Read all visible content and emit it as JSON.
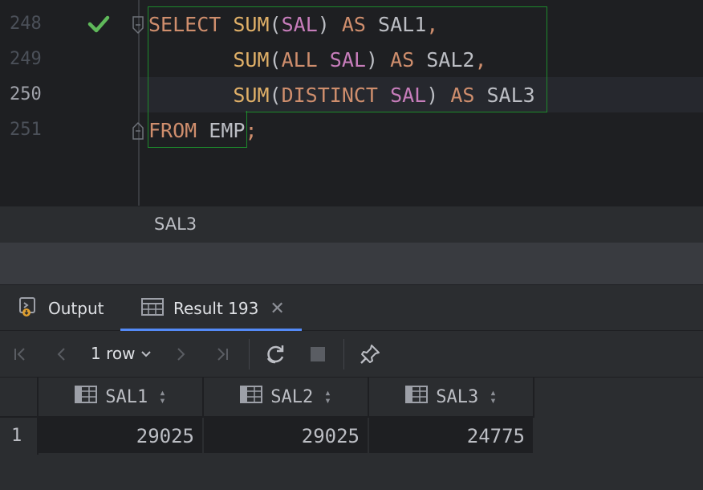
{
  "editor": {
    "lines": [
      {
        "number": "248",
        "segments": [
          {
            "t": "SELECT",
            "c": "kw"
          },
          {
            "t": " ",
            "c": "punc"
          },
          {
            "t": "SUM",
            "c": "fn"
          },
          {
            "t": "(",
            "c": "punc"
          },
          {
            "t": "SAL",
            "c": "col"
          },
          {
            "t": ")",
            "c": "punc"
          },
          {
            "t": " ",
            "c": "punc"
          },
          {
            "t": "AS",
            "c": "kw"
          },
          {
            "t": " SAL1",
            "c": "alias"
          },
          {
            "t": ",",
            "c": "semi"
          }
        ]
      },
      {
        "number": "249",
        "segments": [
          {
            "t": "       ",
            "c": "punc"
          },
          {
            "t": "SUM",
            "c": "fn"
          },
          {
            "t": "(",
            "c": "punc"
          },
          {
            "t": "ALL",
            "c": "kw"
          },
          {
            "t": " ",
            "c": "punc"
          },
          {
            "t": "SAL",
            "c": "col"
          },
          {
            "t": ")",
            "c": "punc"
          },
          {
            "t": " ",
            "c": "punc"
          },
          {
            "t": "AS",
            "c": "kw"
          },
          {
            "t": " SAL2",
            "c": "alias"
          },
          {
            "t": ",",
            "c": "semi"
          }
        ]
      },
      {
        "number": "250",
        "segments": [
          {
            "t": "       ",
            "c": "punc"
          },
          {
            "t": "SUM",
            "c": "fn"
          },
          {
            "t": "(",
            "c": "punc"
          },
          {
            "t": "DISTINCT",
            "c": "kw"
          },
          {
            "t": " ",
            "c": "punc"
          },
          {
            "t": "SAL",
            "c": "col"
          },
          {
            "t": ")",
            "c": "punc"
          },
          {
            "t": " ",
            "c": "punc"
          },
          {
            "t": "AS",
            "c": "kw"
          },
          {
            "t": " SAL3",
            "c": "alias"
          }
        ]
      },
      {
        "number": "251",
        "segments": [
          {
            "t": "FROM",
            "c": "kw"
          },
          {
            "t": " EMP",
            "c": "alias"
          },
          {
            "t": ";",
            "c": "semi"
          }
        ]
      }
    ],
    "current_line": "250",
    "status_icon": "checkmark-icon"
  },
  "breadcrumb": "SAL3",
  "tool_window": {
    "tabs": [
      {
        "label": "Output",
        "icon": "output-icon"
      },
      {
        "label": "Result 193",
        "icon": "table-icon",
        "active": true,
        "closable": true
      }
    ],
    "toolbar": {
      "rows_label": "1 row",
      "buttons": [
        "first-page-icon",
        "previous-page-icon",
        "next-page-icon",
        "last-page-icon",
        "refresh-icon",
        "stop-icon",
        "pin-icon"
      ]
    }
  },
  "grid": {
    "columns": [
      "SAL1",
      "SAL2",
      "SAL3"
    ],
    "rows": [
      {
        "index": "1",
        "values": [
          "29025",
          "29025",
          "24775"
        ]
      }
    ]
  },
  "colors": {
    "keyword": "#cf8e6d",
    "function": "#e0b068",
    "column": "#c77dbb",
    "text": "#bcbec4",
    "success": "#5fb85a",
    "highlight_border": "#1d8a2c",
    "accent": "#548af7"
  }
}
